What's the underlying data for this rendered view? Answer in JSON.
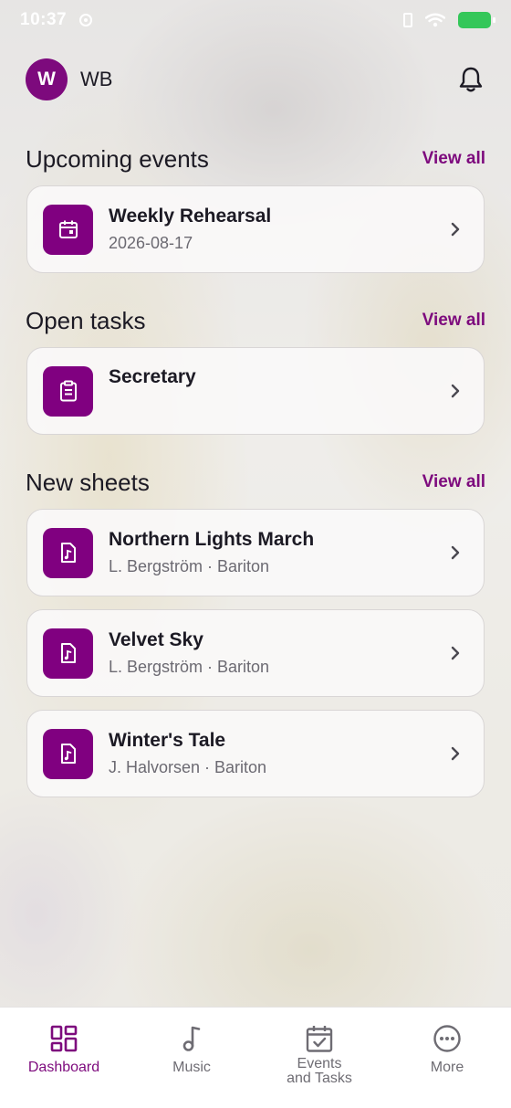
{
  "status_bar": {
    "time": "10:37"
  },
  "header": {
    "avatar_initial": "W",
    "user_initials": "WB"
  },
  "sections": {
    "events": {
      "title": "Upcoming events",
      "view_all": "View all",
      "items": [
        {
          "title": "Weekly Rehearsal",
          "subtitle": "2026-08-17"
        }
      ]
    },
    "tasks": {
      "title": "Open tasks",
      "view_all": "View all",
      "items": [
        {
          "title": "Secretary"
        }
      ]
    },
    "sheets": {
      "title": "New sheets",
      "view_all": "View all",
      "items": [
        {
          "title": "Northern Lights March",
          "subtitle": "L. Bergström · Bariton"
        },
        {
          "title": "Velvet Sky",
          "subtitle": "L. Bergström · Bariton"
        },
        {
          "title": "Winter's Tale",
          "subtitle": "J. Halvorsen · Bariton"
        }
      ]
    }
  },
  "tabbar": {
    "tabs": [
      {
        "label": "Dashboard",
        "icon": "dashboard-icon",
        "active": true
      },
      {
        "label": "Music",
        "icon": "music-note-icon",
        "active": false
      },
      {
        "label": "Events and Tasks",
        "icon": "calendar-check-icon",
        "active": false
      },
      {
        "label": "More",
        "icon": "more-icon",
        "active": false
      }
    ]
  },
  "colors": {
    "accent": "#7d0a7d",
    "battery": "#34c759"
  }
}
